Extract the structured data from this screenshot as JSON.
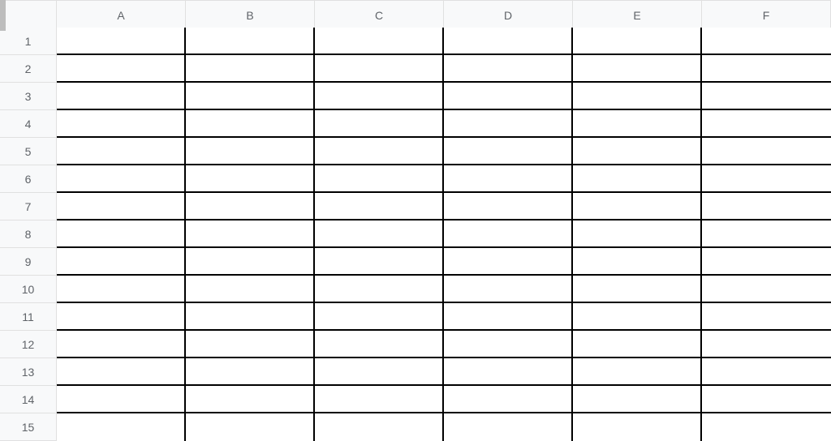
{
  "columns": [
    "A",
    "B",
    "C",
    "D",
    "E",
    "F"
  ],
  "rows": [
    "1",
    "2",
    "3",
    "4",
    "5",
    "6",
    "7",
    "8",
    "9",
    "10",
    "11",
    "12",
    "13",
    "14",
    "15"
  ],
  "cells": {}
}
